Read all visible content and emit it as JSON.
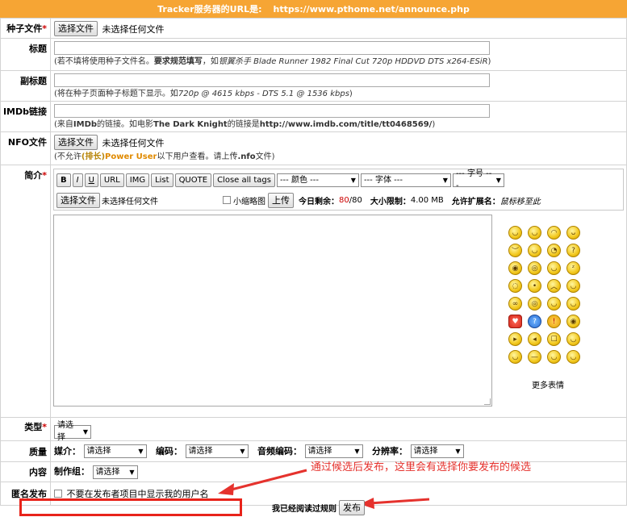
{
  "tracker": {
    "label": "Tracker服务器的URL是:",
    "url": "https://www.pthome.net/announce.php"
  },
  "torrent": {
    "label": "种子文件",
    "button": "选择文件",
    "status": "未选择任何文件"
  },
  "title_row": {
    "label": "标题",
    "hint_pre": "(若不填将使用种子文件名。",
    "hint_bold": "要求规范填写",
    "hint_mid": "，如",
    "hint_italic": "银翼杀手 Blade Runner 1982 Final Cut 720p HDDVD DTS x264-ESiR",
    "hint_post": ")"
  },
  "subtitle_row": {
    "label": "副标题",
    "hint_pre": "(将在种子页面种子标题下显示。如",
    "hint_italic": "720p @ 4615 kbps - DTS 5.1 @ 1536 kbps",
    "hint_post": ")"
  },
  "imdb_row": {
    "label": "IMDb链接",
    "hint_pre": "(来自",
    "hint_b1": "IMDb",
    "hint_mid": "的链接。如电影",
    "hint_b2": "The Dark Knight",
    "hint_mid2": "的链接是",
    "hint_b3": "http://www.imdb.com/title/tt0468569/",
    "hint_post": ")"
  },
  "nfo_row": {
    "label": "NFO文件",
    "button": "选择文件",
    "status": "未选择任何文件",
    "hint_pre": "(不允许",
    "hint_rank": "(排长)",
    "hint_pu": "Power User",
    "hint_mid": "以下用户查看。请上传",
    "hint_b": ".nfo",
    "hint_post": "文件)"
  },
  "desc_row": {
    "label": "简介",
    "toolbar": {
      "bold": "B",
      "italic": "I",
      "underline": "U",
      "url": "URL",
      "img": "IMG",
      "list": "List",
      "quote": "QUOTE",
      "close": "Close all tags",
      "color": "--- 颜色 ---",
      "font": "--- 字体 ---",
      "size": "--- 字号 ---"
    },
    "upload": {
      "button": "选择文件",
      "status": "未选择任何文件",
      "thumb": "小缩略图",
      "upload_btn": "上传",
      "today_label": "今日剩余：",
      "today_used": "80",
      "today_total": "/80",
      "size_label": "大小限制：",
      "size_value": "4.00 MB",
      "ext_label": "允许扩展名：",
      "ext_value": "鼠标移至此"
    },
    "more_smilies": "更多表情"
  },
  "type_row": {
    "label": "类型",
    "select": "请选择"
  },
  "quality_row": {
    "label": "质量",
    "media_label": "媒介：",
    "media": "请选择",
    "codec_label": "编码：",
    "codec": "请选择",
    "audio_label": "音频编码：",
    "audio": "请选择",
    "res_label": "分辨率：",
    "res": "请选择"
  },
  "content_row": {
    "label": "内容",
    "team_label": "制作组：",
    "team": "请选择"
  },
  "anon_row": {
    "label": "匿名发布",
    "checkbox_label": "不要在发布者项目中显示我的用户名"
  },
  "annotation": "通过候选后发布，这里会有选择你要发布的候选",
  "submit": {
    "rules": "我已经阅读过规则",
    "button": "发布"
  },
  "colors": {
    "header": "#f6a534",
    "annotation": "#e5322d",
    "box": "#e8231a"
  }
}
